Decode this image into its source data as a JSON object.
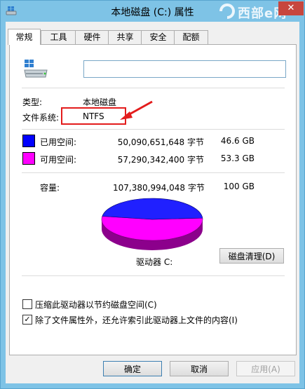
{
  "window": {
    "title": "本地磁盘 (C:) 属性",
    "close_glyph": "✕",
    "watermark": "西部e网"
  },
  "tabs": [
    "常规",
    "工具",
    "硬件",
    "共享",
    "安全",
    "配额"
  ],
  "general": {
    "name_value": "",
    "type_label": "类型:",
    "type_value": "本地磁盘",
    "fs_label": "文件系统:",
    "fs_value": "NTFS",
    "used_label": "已用空间:",
    "used_bytes": "50,090,651,648 字节",
    "used_size": "46.6 GB",
    "free_label": "可用空间:",
    "free_bytes": "57,290,342,400 字节",
    "free_size": "53.3 GB",
    "capacity_label": "容量:",
    "capacity_bytes": "107,380,994,048 字节",
    "capacity_size": "100 GB",
    "drive_label": "驱动器 C:",
    "cleanup_button": "磁盘清理(D)",
    "compress_label": "压缩此驱动器以节约磁盘空间(C)",
    "compress_checked": false,
    "index_label": "除了文件属性外，还允许索引此驱动器上文件的内容(I)",
    "index_checked": true,
    "used_fraction": 0.466
  },
  "colors": {
    "used": "#0000ff",
    "free": "#ff00ff",
    "annotation": "#e31c1c"
  },
  "buttons": {
    "ok": "确定",
    "cancel": "取消",
    "apply": "应用(A)"
  }
}
